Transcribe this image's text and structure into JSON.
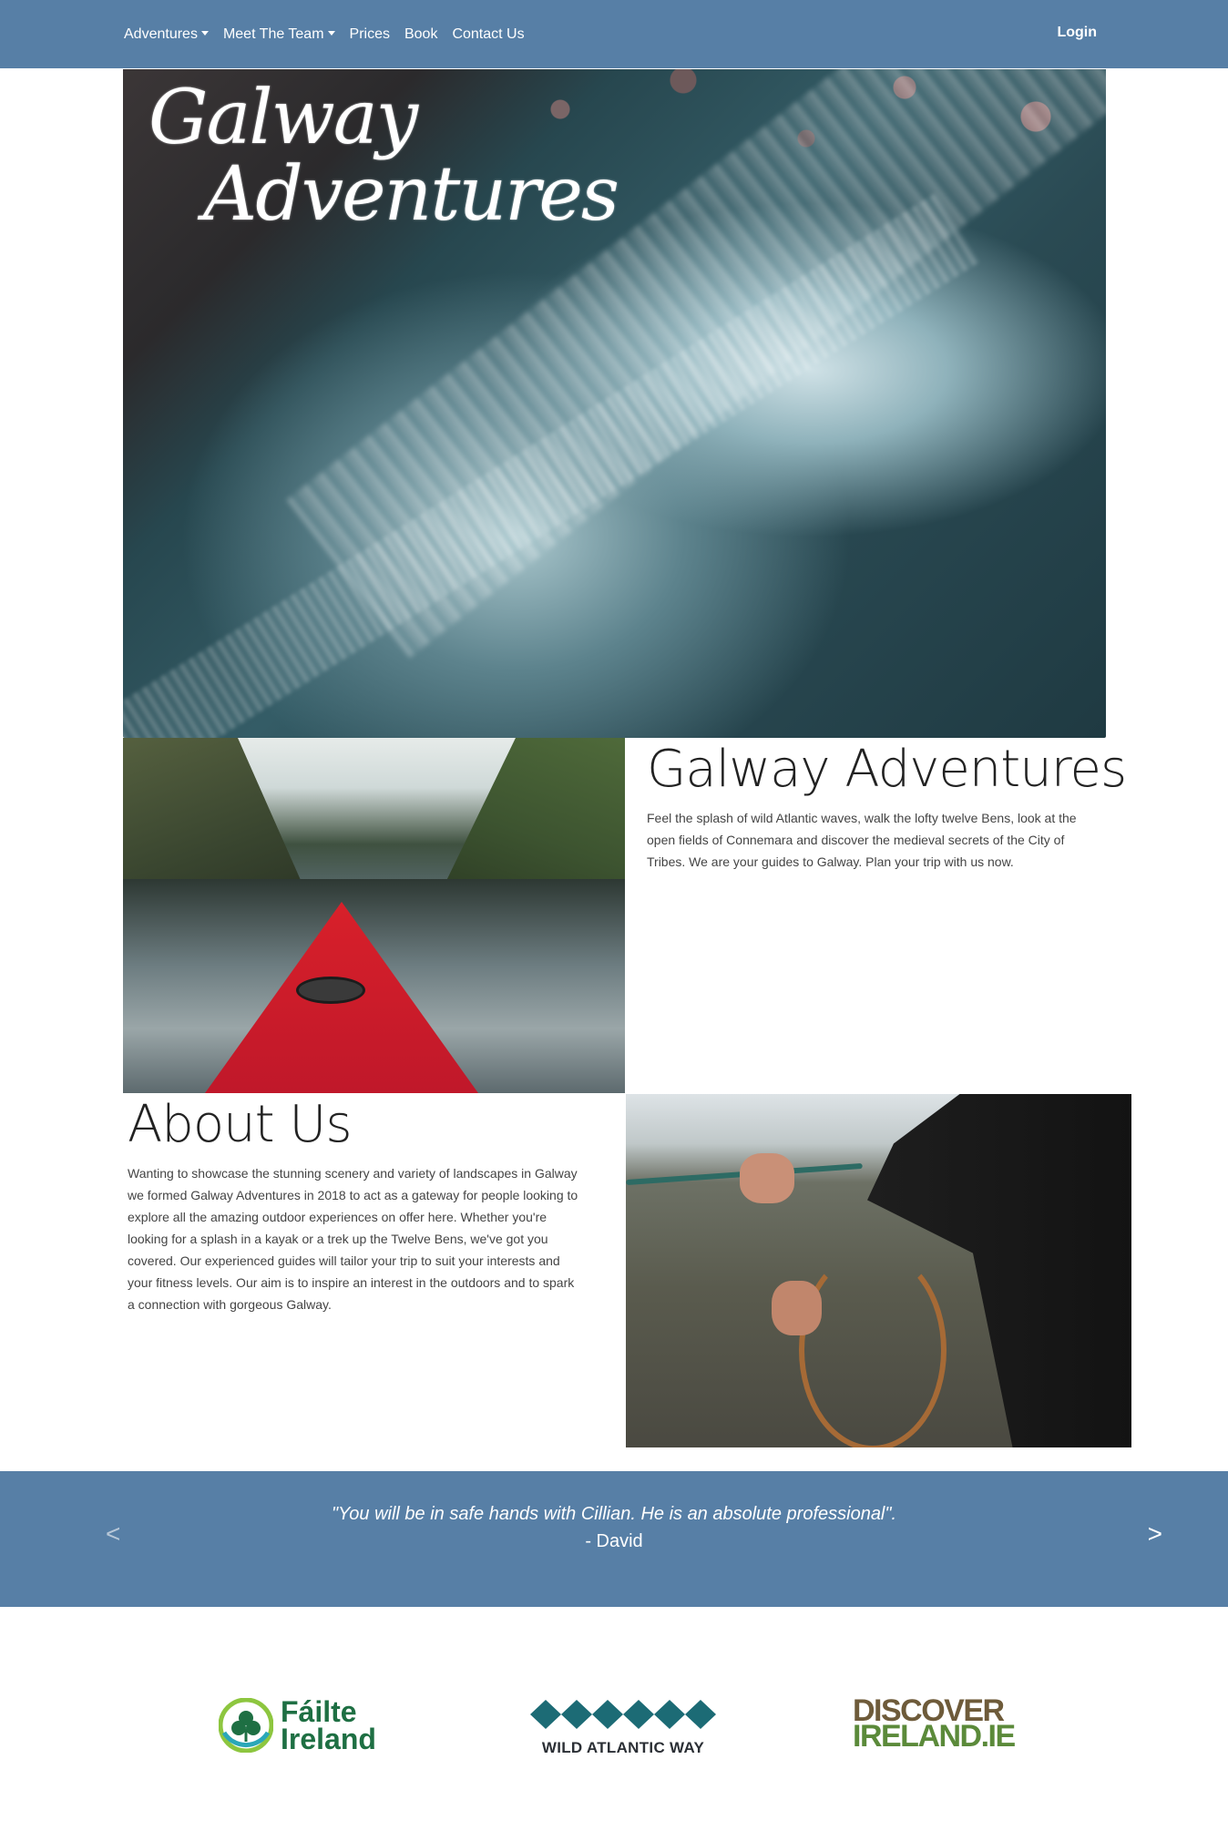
{
  "nav": {
    "items": [
      {
        "label": "Adventures",
        "dropdown": true
      },
      {
        "label": "Meet The Team",
        "dropdown": true
      },
      {
        "label": "Prices",
        "dropdown": false
      },
      {
        "label": "Book",
        "dropdown": false
      },
      {
        "label": "Contact Us",
        "dropdown": false
      }
    ],
    "login": "Login"
  },
  "hero": {
    "logo_line1": "Galway",
    "logo_line2": "Adventures"
  },
  "intro": {
    "title": "Galway Adventures",
    "text": "Feel the splash of wild Atlantic waves, walk the lofty twelve Bens, look at the open fields of Connemara and discover the medieval secrets of the City of Tribes. We are your guides to Galway. Plan your trip with us now."
  },
  "about": {
    "title": "About Us",
    "text": "Wanting to showcase the stunning scenery and variety of landscapes in Galway we formed Galway Adventures in 2018 to act as a gateway for people looking to explore all the amazing outdoor experiences on offer here. Whether you're looking for a splash in a kayak or a trek up the Twelve Bens, we've got you covered. Our experienced guides will tailor your trip to suit your interests and your fitness levels. Our aim is to inspire an interest in the outdoors and to spark a connection with gorgeous Galway."
  },
  "testimonial": {
    "quote": "\"You will be in safe hands with Cillian. He is an absolute professional\".",
    "author": "- David",
    "prev": "<",
    "next": ">"
  },
  "partners": {
    "failte_line1": "Fáilte",
    "failte_line2": "Ireland",
    "wild_atlantic": "WILD ATLANTIC WAY",
    "discover_line1": "DISCOVER",
    "discover_line2": "IRELAND.IE"
  },
  "colors": {
    "navbar": "#577fa6",
    "testimonial_bg": "#577fa6",
    "failte_green": "#1e6f43",
    "waw_teal": "#1c6b75"
  }
}
